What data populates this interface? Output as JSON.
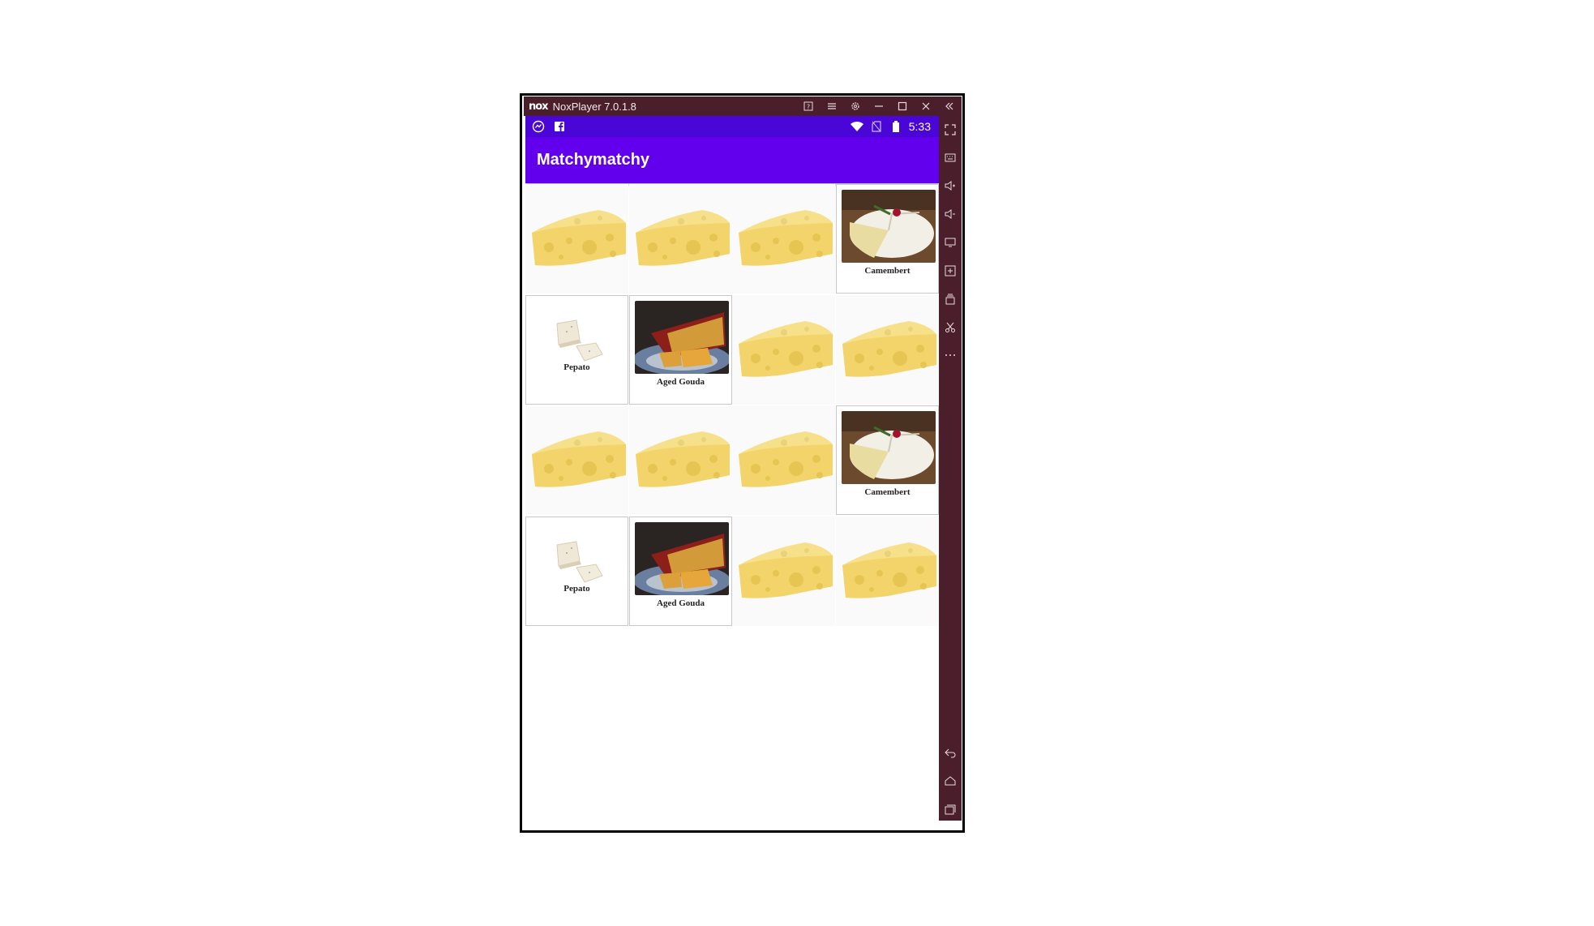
{
  "window": {
    "logo_text": "nox",
    "title": "NoxPlayer 7.0.1.8",
    "controls": [
      "help-icon",
      "menu-icon",
      "settings-icon",
      "minimize-icon",
      "maximize-icon",
      "close-icon",
      "collapse-sidebar-icon"
    ]
  },
  "statusbar": {
    "left_icons": [
      "messenger-icon",
      "facebook-icon"
    ],
    "right_icons": [
      "wifi-icon",
      "no-sim-icon",
      "battery-icon"
    ],
    "time": "5:33"
  },
  "app": {
    "title": "Matchymatchy"
  },
  "board": {
    "rows": 4,
    "columns": 4,
    "cards": [
      {
        "state": "hidden"
      },
      {
        "state": "hidden"
      },
      {
        "state": "hidden"
      },
      {
        "state": "revealed",
        "label": "Camembert"
      },
      {
        "state": "revealed",
        "label": "Pepato"
      },
      {
        "state": "revealed",
        "label": "Aged Gouda"
      },
      {
        "state": "hidden"
      },
      {
        "state": "hidden"
      },
      {
        "state": "hidden"
      },
      {
        "state": "hidden"
      },
      {
        "state": "hidden"
      },
      {
        "state": "revealed",
        "label": "Camembert"
      },
      {
        "state": "revealed",
        "label": "Pepato"
      },
      {
        "state": "revealed",
        "label": "Aged Gouda"
      },
      {
        "state": "hidden"
      },
      {
        "state": "hidden"
      }
    ]
  },
  "sidebar_tools": [
    "fullscreen-icon",
    "keyboard-icon",
    "volume-up-icon",
    "volume-down-icon",
    "screen-icon",
    "add-apk-icon",
    "multi-instance-icon",
    "screenshot-icon",
    "more-icon",
    "back-icon",
    "home-icon",
    "recent-apps-icon"
  ],
  "colors": {
    "nox_frame": "#4a1f2b",
    "statusbar": "#4a06d6",
    "appbar": "#6200ee",
    "cheese": "#f6e18a"
  }
}
